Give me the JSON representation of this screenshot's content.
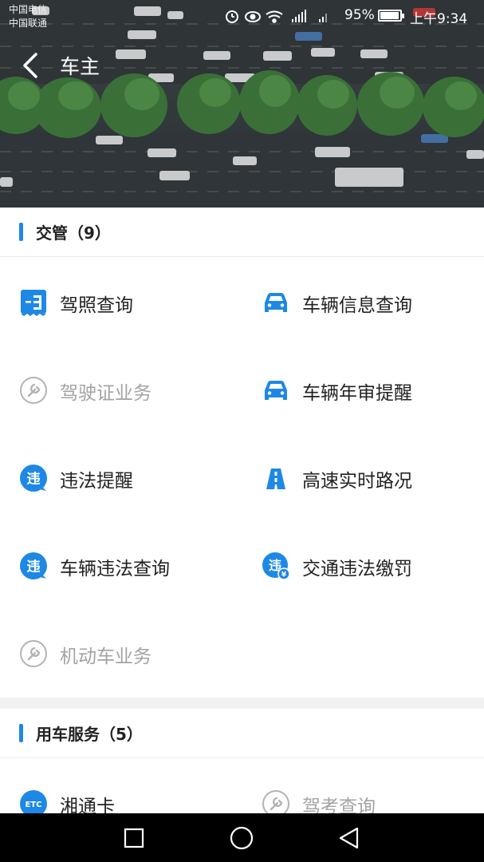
{
  "status_bar": {
    "carrier_1": "中国电信",
    "carrier_2": "中国联通",
    "icons": [
      "alarm-icon",
      "eye-icon",
      "wifi-icon",
      "signal-4g-icon",
      "signal-2g-icon"
    ],
    "battery_percent": "95%",
    "battery_level": 0.95,
    "time": "上午9:34"
  },
  "header": {
    "title": "车主",
    "back_icon": "chevron-left-icon"
  },
  "sections": {
    "traffic": {
      "title": "交管（9）",
      "items": [
        {
          "label": "驾照查询",
          "icon": "license-icon",
          "enabled": true
        },
        {
          "label": "车辆信息查询",
          "icon": "car-icon",
          "enabled": true
        },
        {
          "label": "驾驶证业务",
          "icon": "wrench-icon",
          "enabled": false
        },
        {
          "label": "车辆年审提醒",
          "icon": "car-icon",
          "enabled": true
        },
        {
          "label": "违法提醒",
          "icon": "violation-icon",
          "enabled": true
        },
        {
          "label": "高速实时路况",
          "icon": "highway-icon",
          "enabled": true
        },
        {
          "label": "车辆违法查询",
          "icon": "violation-icon",
          "enabled": true
        },
        {
          "label": "交通违法缴罚",
          "icon": "violation-pay-icon",
          "enabled": true
        },
        {
          "label": "机动车业务",
          "icon": "wrench-icon",
          "enabled": false
        }
      ]
    },
    "car_service": {
      "title": "用车服务（5）",
      "items": [
        {
          "label": "湘通卡",
          "icon": "etc-icon",
          "enabled": true
        },
        {
          "label": "驾考查询",
          "icon": "wrench-icon",
          "enabled": false
        }
      ]
    }
  },
  "nav_bar": {
    "recent": "square-icon",
    "home": "circle-icon",
    "back": "triangle-back-icon"
  },
  "colors": {
    "accent": "#1e88e5",
    "text": "#222222",
    "disabled_text": "#a3a3a3"
  },
  "glyphs": {
    "violation": "违",
    "yen": "¥",
    "etc": "ETC"
  }
}
